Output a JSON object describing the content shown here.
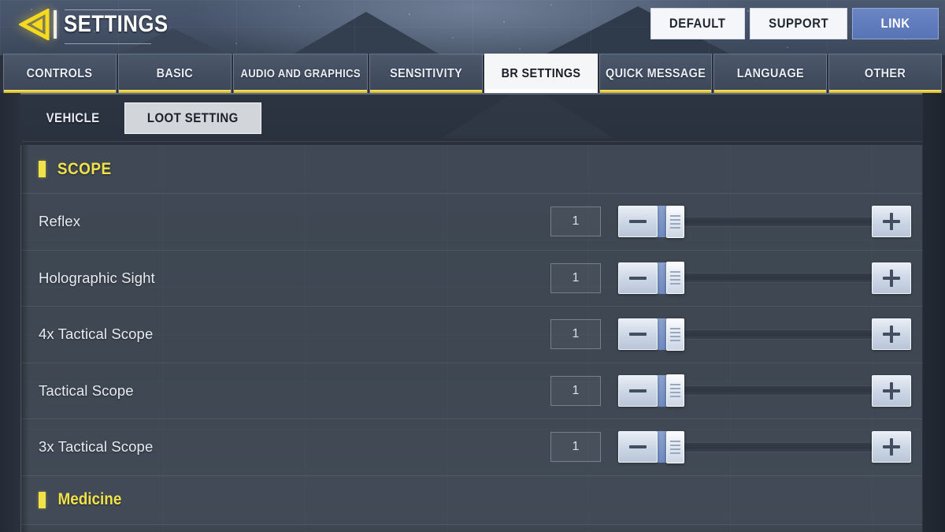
{
  "header": {
    "back_icon": "back-arrow-icon",
    "title": "SETTINGS",
    "buttons": [
      {
        "label": "DEFAULT",
        "style": "light"
      },
      {
        "label": "SUPPORT",
        "style": "light"
      },
      {
        "label": "LINK",
        "style": "primary"
      }
    ],
    "accent_yellow": "#f2e24a",
    "link_blue": "#5774b5"
  },
  "tabs": [
    {
      "label": "CONTROLS",
      "active": false
    },
    {
      "label": "BASIC",
      "active": false
    },
    {
      "label": "AUDIO AND GRAPHICS",
      "active": false
    },
    {
      "label": "SENSITIVITY",
      "active": false
    },
    {
      "label": "BR SETTINGS",
      "active": true
    },
    {
      "label": "QUICK MESSAGE",
      "active": false
    },
    {
      "label": "LANGUAGE",
      "active": false
    },
    {
      "label": "OTHER",
      "active": false
    }
  ],
  "subtabs": [
    {
      "label": "VEHICLE",
      "active": false
    },
    {
      "label": "LOOT SETTING",
      "active": true
    }
  ],
  "sections": [
    {
      "title": "SCOPE",
      "style": "caps",
      "rows": [
        {
          "label": "Reflex",
          "value": "1",
          "percent": 0,
          "minus": "−",
          "plus": "+"
        },
        {
          "label": "Holographic Sight",
          "value": "1",
          "percent": 0,
          "minus": "−",
          "plus": "+"
        },
        {
          "label": "4x Tactical Scope",
          "value": "1",
          "percent": 0,
          "minus": "−",
          "plus": "+"
        },
        {
          "label": "Tactical Scope",
          "value": "1",
          "percent": 0,
          "minus": "−",
          "plus": "+"
        },
        {
          "label": "3x Tactical Scope",
          "value": "1",
          "percent": 0,
          "minus": "−",
          "plus": "+"
        }
      ]
    },
    {
      "title": "Medicine",
      "style": "mixed",
      "rows": []
    }
  ]
}
